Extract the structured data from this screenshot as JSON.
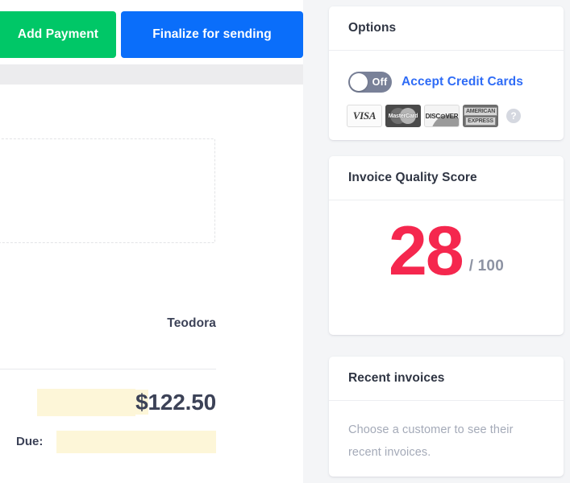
{
  "theme": {
    "page_bg": "#f4f5f7",
    "accent_blue": "#0a6efa",
    "accent_green": "#00c767",
    "link_blue": "#2f6cf6",
    "score_red": "#f5274e",
    "highlight_yellow": "#fdf6d8",
    "text_dark": "#3c4257",
    "text_muted": "#a4aab8"
  },
  "actions": {
    "add_payment_label": "Add Payment",
    "finalize_label": "Finalize for sending"
  },
  "invoice": {
    "dropzone_label": "",
    "signee_name": "Teodora",
    "total_amount": "$122.50",
    "total_currency_symbol": "$",
    "total_number": "122.50",
    "due_label": "Due:",
    "due_value": ""
  },
  "sidebar": {
    "options": {
      "title": "Options",
      "toggle_state_label": "Off",
      "toggle_on": false,
      "accept_cards_label": "Accept Credit Cards",
      "help_icon_label": "?",
      "card_brands": [
        {
          "name": "visa",
          "label": "VISA"
        },
        {
          "name": "mastercard",
          "label": "MasterCard"
        },
        {
          "name": "discover",
          "label": "DISC⊙VER"
        },
        {
          "name": "amex",
          "line1": "AMERICAN",
          "line2": "EXPRESS"
        }
      ]
    },
    "score": {
      "title": "Invoice Quality Score",
      "value": "28",
      "max_label": "/ 100",
      "max": 100
    },
    "recent": {
      "title": "Recent invoices",
      "empty_message": "Choose a customer to see their recent invoices."
    }
  }
}
